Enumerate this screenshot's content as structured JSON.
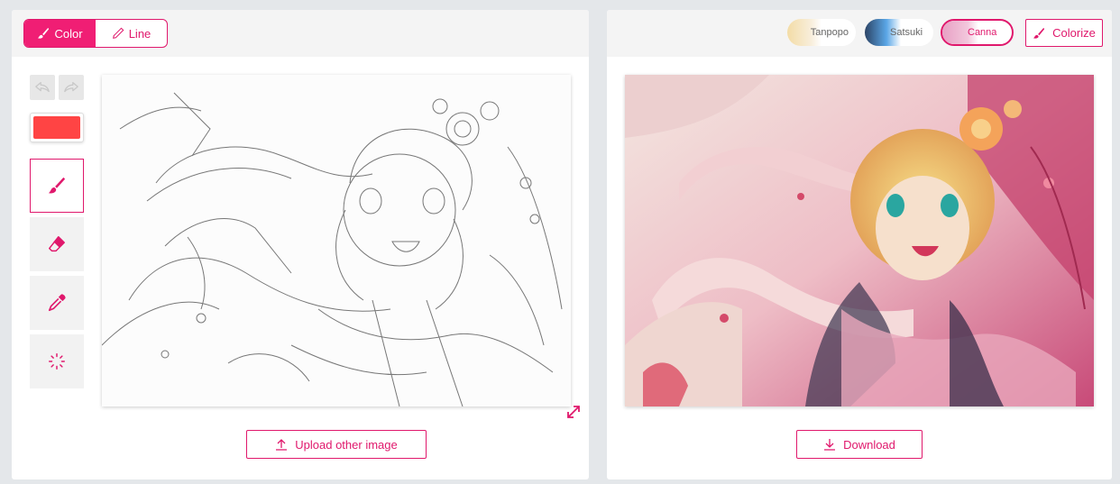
{
  "mode_toggle": {
    "color_label": "Color",
    "line_label": "Line",
    "active": "color"
  },
  "tools": {
    "undo_icon": "undo-icon",
    "redo_icon": "redo-icon",
    "current_color": "#ff4444",
    "items": [
      {
        "name": "brush",
        "icon": "brush-icon",
        "active": true
      },
      {
        "name": "eraser",
        "icon": "eraser-icon",
        "active": false
      },
      {
        "name": "eyedropper",
        "icon": "eyedropper-icon",
        "active": false
      },
      {
        "name": "hint-clear",
        "icon": "loading-icon",
        "active": false
      }
    ]
  },
  "left_panel": {
    "upload_label": "Upload other image"
  },
  "styles": [
    {
      "label": "Tanpopo",
      "active": false,
      "thumb_color": "#f3dca6"
    },
    {
      "label": "Satsuki",
      "active": false,
      "thumb_color": "#5aa6e6"
    },
    {
      "label": "Canna",
      "active": true,
      "thumb_color": "#f2a7c8"
    }
  ],
  "right_panel": {
    "colorize_label": "Colorize",
    "download_label": "Download"
  },
  "colors": {
    "accent": "#e0186c",
    "accent_fill": "#f01e74",
    "panel_bg": "#ffffff",
    "page_bg": "#e4e7ea"
  }
}
